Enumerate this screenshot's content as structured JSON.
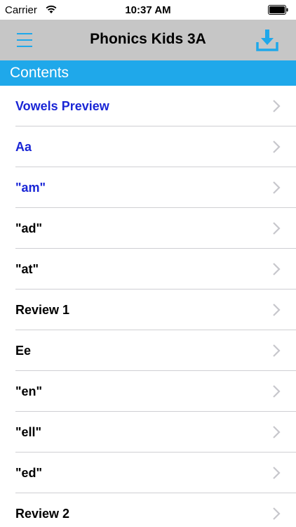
{
  "status_bar": {
    "carrier": "Carrier",
    "time": "10:37 AM"
  },
  "nav": {
    "title": "Phonics Kids 3A"
  },
  "section": {
    "title": "Contents"
  },
  "colors": {
    "accent": "#1fa8ea",
    "nav_bg": "#c6c6c6",
    "completed_text": "#1a26d6"
  },
  "items": [
    {
      "label": "Vowels Preview",
      "completed": true
    },
    {
      "label": "Aa",
      "completed": true
    },
    {
      "label": "\"am\"",
      "completed": true
    },
    {
      "label": "\"ad\"",
      "completed": false
    },
    {
      "label": "\"at\"",
      "completed": false
    },
    {
      "label": "Review 1",
      "completed": false
    },
    {
      "label": "Ee",
      "completed": false
    },
    {
      "label": "\"en\"",
      "completed": false
    },
    {
      "label": "\"ell\"",
      "completed": false
    },
    {
      "label": "\"ed\"",
      "completed": false
    },
    {
      "label": "Review 2",
      "completed": false
    }
  ]
}
